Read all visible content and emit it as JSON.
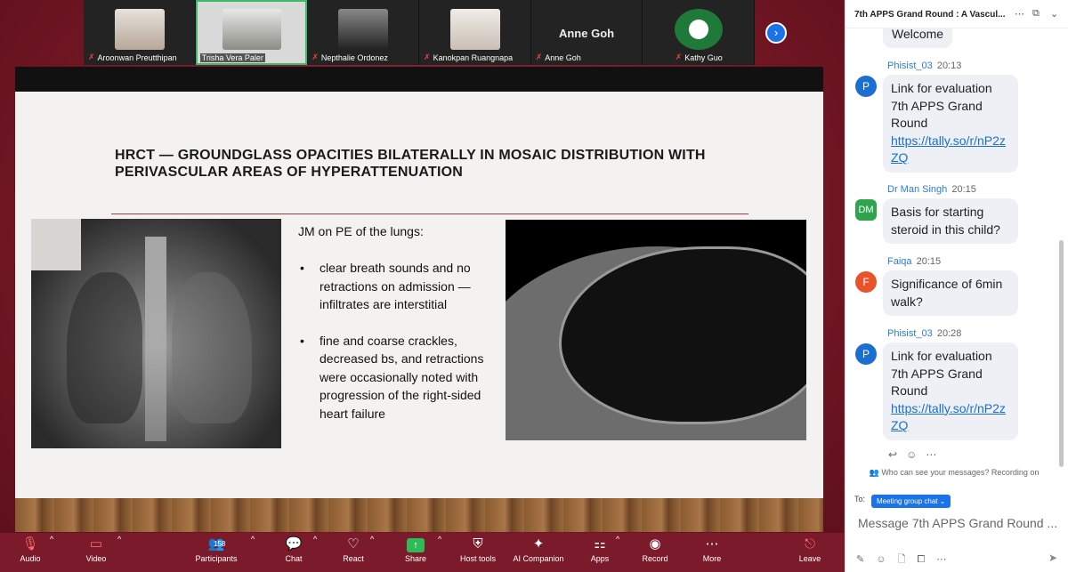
{
  "participants": [
    {
      "name": "Aroonwan Preutthipan",
      "photo_color": "#c9c0b6",
      "muted": true
    },
    {
      "name": "Trisha Vera Paler",
      "photo_color": "#b9b4a8",
      "muted": false,
      "active": true
    },
    {
      "name": "Nepthalie Ordonez",
      "photo_color": "#4a4a4a",
      "muted": true
    },
    {
      "name": "Kanokpan Ruangnapa",
      "photo_color": "#d8d0c8",
      "muted": true
    },
    {
      "name": "Anne Goh",
      "display_big": "Anne Goh",
      "muted": true
    },
    {
      "name": "Kathy Guo",
      "photo_color": "#1f7a3a",
      "muted": true
    }
  ],
  "slide": {
    "title": "HRCT — GROUNDGLASS OPACITIES BILATERALLY IN MOSAIC DISTRIBUTION WITH PERIVASCULAR AREAS OF HYPERATTENUATION",
    "pe_heading": "JM on PE of the lungs:",
    "bullets": [
      "clear breath sounds and no retractions on admission — infiltrates are interstitial",
      "fine and coarse crackles, decreased bs, and retractions were occasionally noted with progression of the right-sided heart failure"
    ]
  },
  "toolbar": {
    "audio": "Audio",
    "video": "Video",
    "participants": "Participants",
    "participants_count": "158",
    "chat": "Chat",
    "react": "React",
    "share": "Share",
    "host_tools": "Host tools",
    "ai_companion": "AI Companion",
    "apps": "Apps",
    "record": "Record",
    "more": "More",
    "leave": "Leave"
  },
  "chat": {
    "title": "7th APPS Grand Round : A Vascul...",
    "welcome": "Welcome",
    "messages": [
      {
        "sender": "Phisist_03",
        "time": "20:13",
        "avatar": "P",
        "avatar_color": "#1a6fd0",
        "text": "Link for evaluation 7th APPS Grand Round",
        "link": "https://tally.so/r/nP2zZQ"
      },
      {
        "sender": "Dr Man Singh",
        "time": "20:15",
        "avatar": "DM",
        "avatar_color": "#2fa34e",
        "text": "Basis for starting steroid in this child?"
      },
      {
        "sender": "Faiqa",
        "time": "20:15",
        "avatar": "F",
        "avatar_color": "#e8532a",
        "text": "Significance of 6min walk?"
      },
      {
        "sender": "Phisist_03",
        "time": "20:28",
        "avatar": "P",
        "avatar_color": "#1a6fd0",
        "text": "Link for evaluation 7th APPS Grand Round",
        "link": "https://tally.so/r/nP2zZQ"
      }
    ],
    "privacy_note": "Who can see your messages? Recording on",
    "to_label": "To:",
    "recipient": "Meeting group chat",
    "compose_placeholder": "Message 7th APPS Grand Round ..."
  }
}
